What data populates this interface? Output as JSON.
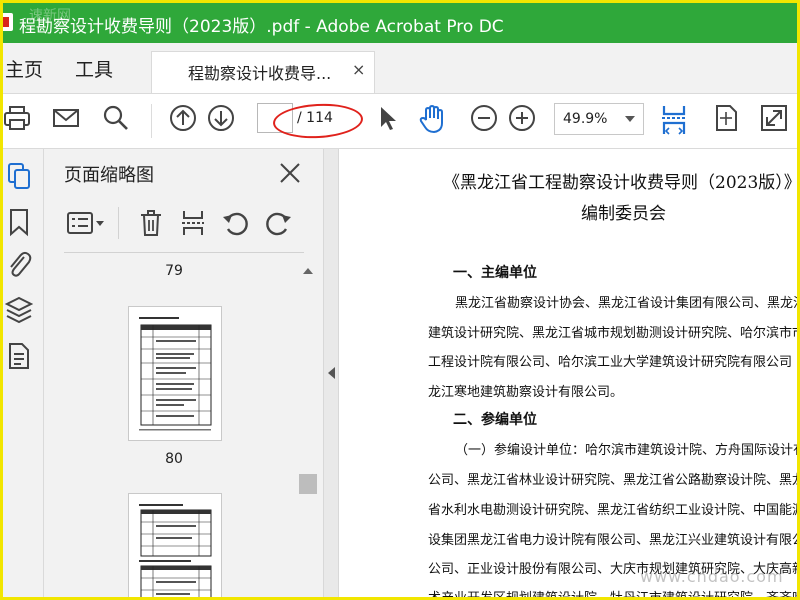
{
  "window": {
    "title": "程勘察设计收费导则（2023版）.pdf - Adobe Acrobat Pro DC",
    "watermark_top": "速新网"
  },
  "menu": {
    "home": "主页",
    "tools": "工具",
    "document_tab": "程勘察设计收费导...",
    "close_glyph": "×"
  },
  "toolbar": {
    "page_input": "",
    "page_total": "/ 114",
    "zoom": "49.9%"
  },
  "thumbnails": {
    "title": "页面缩略图",
    "page_numbers": [
      "79",
      "80"
    ]
  },
  "document": {
    "title_line1": "《黑龙江省工程勘察设计收费导则（2023版）》",
    "title_line2": "编制委员会",
    "section1": "一、主编单位",
    "section2": "二、参编单位",
    "lines": [
      "黑龙江省勘察设计协会、黑龙江省设计集团有限公司、黑龙江",
      "建筑设计研究院、黑龙江省城市规划勘测设计研究院、哈尔滨市市",
      "工程设计院有限公司、哈尔滨工业大学建筑设计研究院有限公司",
      "龙江寒地建筑勘察设计有限公司。",
      "（一）参编设计单位：哈尔滨市建筑设计院、方舟国际设计有",
      "公司、黑龙江省林业设计研究院、黑龙江省公路勘察设计院、黑龙",
      "省水利水电勘测设计研究院、黑龙江省纺织工业设计院、中国能源",
      "设集团黑龙江省电力设计院有限公司、黑龙江兴业建筑设计有限公",
      "公司、正业设计股份有限公司、大庆市规划建筑研究院、大庆高新",
      "术产业开发区规划建筑设计院、牡丹江市建筑设计研究院、齐齐哈"
    ]
  },
  "watermark_bottom": "www.cndao.com",
  "colors": {
    "titlebar": "#2fa83a",
    "accent_blue": "#1f6fd1",
    "annotation_red": "#e0221c",
    "frame_yellow": "#f2e600"
  },
  "icons": [
    "pdf-app-icon",
    "print-icon",
    "mail-icon",
    "search-icon",
    "prev-page-icon",
    "next-page-icon",
    "select-pointer-icon",
    "hand-tool-icon",
    "zoom-out-icon",
    "zoom-in-icon",
    "scroll-mode-icon",
    "fit-page-icon",
    "fullscreen-icon",
    "page-thumbnails-icon",
    "bookmarks-icon",
    "attachments-icon",
    "layers-icon",
    "content-icon",
    "close-icon",
    "thumbnail-options-icon",
    "delete-page-icon",
    "insert-page-icon",
    "rotate-ccw-icon",
    "rotate-cw-icon"
  ]
}
